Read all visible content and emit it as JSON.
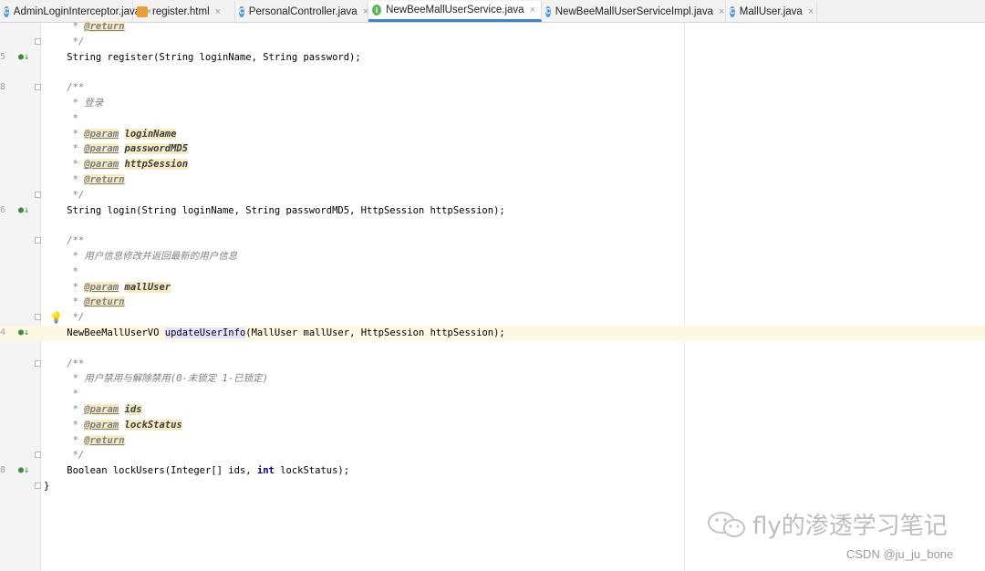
{
  "tabs": [
    {
      "icon": "c-class-icon",
      "label": "AdminLoginInterceptor.java",
      "active": false
    },
    {
      "icon": "html-file-icon",
      "label": "register.html",
      "active": false
    },
    {
      "icon": "c-class-icon",
      "label": "PersonalController.java",
      "active": false
    },
    {
      "icon": "i-interface-icon",
      "label": "NewBeeMallUserService.java",
      "active": true
    },
    {
      "icon": "c-class-icon",
      "label": "NewBeeMallUserServiceImpl.java",
      "active": false
    },
    {
      "icon": "c-class-icon",
      "label": "MallUser.java",
      "active": false
    }
  ],
  "tab_close_glyph": "×",
  "lines": [
    {
      "num": "",
      "gutter": "",
      "fold": false,
      "segments": [
        {
          "t": "     * ",
          "c": "cm"
        },
        {
          "t": "@return",
          "c": "tag"
        }
      ]
    },
    {
      "num": "",
      "gutter": "",
      "fold": true,
      "segments": [
        {
          "t": "     */",
          "c": "cm"
        }
      ]
    },
    {
      "num": "5",
      "gutter": "impl-icon",
      "fold": false,
      "segments": [
        {
          "t": "    String register(String loginName, String password);",
          "c": ""
        }
      ]
    },
    {
      "num": "",
      "gutter": "",
      "fold": false,
      "segments": []
    },
    {
      "num": "8",
      "gutter": "",
      "fold": true,
      "segments": [
        {
          "t": "    /**",
          "c": "cm"
        }
      ]
    },
    {
      "num": "",
      "gutter": "",
      "fold": false,
      "segments": [
        {
          "t": "     * 登录",
          "c": "cm"
        }
      ]
    },
    {
      "num": "",
      "gutter": "",
      "fold": false,
      "segments": [
        {
          "t": "     *",
          "c": "cm"
        }
      ]
    },
    {
      "num": "",
      "gutter": "",
      "fold": false,
      "segments": [
        {
          "t": "     * ",
          "c": "cm"
        },
        {
          "t": "@param",
          "c": "tag"
        },
        {
          "t": " ",
          "c": "cm"
        },
        {
          "t": "loginName",
          "c": "pn"
        }
      ]
    },
    {
      "num": "",
      "gutter": "",
      "fold": false,
      "segments": [
        {
          "t": "     * ",
          "c": "cm"
        },
        {
          "t": "@param",
          "c": "tag"
        },
        {
          "t": " ",
          "c": "cm"
        },
        {
          "t": "passwordMD5",
          "c": "pn"
        }
      ]
    },
    {
      "num": "",
      "gutter": "",
      "fold": false,
      "segments": [
        {
          "t": "     * ",
          "c": "cm"
        },
        {
          "t": "@param",
          "c": "tag"
        },
        {
          "t": " ",
          "c": "cm"
        },
        {
          "t": "httpSession",
          "c": "pn"
        }
      ]
    },
    {
      "num": "",
      "gutter": "",
      "fold": false,
      "segments": [
        {
          "t": "     * ",
          "c": "cm"
        },
        {
          "t": "@return",
          "c": "tag"
        }
      ]
    },
    {
      "num": "",
      "gutter": "",
      "fold": true,
      "segments": [
        {
          "t": "     */",
          "c": "cm"
        }
      ]
    },
    {
      "num": "6",
      "gutter": "impl-icon",
      "fold": false,
      "segments": [
        {
          "t": "    String login(String loginName, String passwordMD5, HttpSession httpSession);",
          "c": ""
        }
      ]
    },
    {
      "num": "",
      "gutter": "",
      "fold": false,
      "segments": []
    },
    {
      "num": "",
      "gutter": "",
      "fold": true,
      "segments": [
        {
          "t": "    /**",
          "c": "cm"
        }
      ]
    },
    {
      "num": "",
      "gutter": "",
      "fold": false,
      "segments": [
        {
          "t": "     * 用户信息修改并返回最新的用户信息",
          "c": "cm"
        }
      ]
    },
    {
      "num": "",
      "gutter": "",
      "fold": false,
      "segments": [
        {
          "t": "     *",
          "c": "cm"
        }
      ]
    },
    {
      "num": "",
      "gutter": "",
      "fold": false,
      "segments": [
        {
          "t": "     * ",
          "c": "cm"
        },
        {
          "t": "@param",
          "c": "tag"
        },
        {
          "t": " ",
          "c": "cm"
        },
        {
          "t": "mallUser",
          "c": "pn"
        }
      ]
    },
    {
      "num": "",
      "gutter": "",
      "fold": false,
      "segments": [
        {
          "t": "     * ",
          "c": "cm"
        },
        {
          "t": "@return",
          "c": "tag"
        }
      ]
    },
    {
      "num": "",
      "gutter": "",
      "fold": true,
      "bulb": true,
      "segments": [
        {
          "t": "     */",
          "c": "cm"
        }
      ]
    },
    {
      "num": "4",
      "gutter": "impl-icon",
      "fold": false,
      "caret": true,
      "segments": [
        {
          "t": "    NewBeeMallUserVO ",
          "c": ""
        },
        {
          "t": "updateUserInfo",
          "c": "hl"
        },
        {
          "t": "(MallUser mallUser, HttpSession httpSession);",
          "c": ""
        }
      ]
    },
    {
      "num": "",
      "gutter": "",
      "fold": false,
      "segments": []
    },
    {
      "num": "",
      "gutter": "",
      "fold": true,
      "segments": [
        {
          "t": "    /**",
          "c": "cm"
        }
      ]
    },
    {
      "num": "",
      "gutter": "",
      "fold": false,
      "segments": [
        {
          "t": "     * 用户禁用与解除禁用(0-未锁定 1-已锁定)",
          "c": "cm"
        }
      ]
    },
    {
      "num": "",
      "gutter": "",
      "fold": false,
      "segments": [
        {
          "t": "     *",
          "c": "cm"
        }
      ]
    },
    {
      "num": "",
      "gutter": "",
      "fold": false,
      "segments": [
        {
          "t": "     * ",
          "c": "cm"
        },
        {
          "t": "@param",
          "c": "tag"
        },
        {
          "t": " ",
          "c": "cm"
        },
        {
          "t": "ids",
          "c": "pn"
        }
      ]
    },
    {
      "num": "",
      "gutter": "",
      "fold": false,
      "segments": [
        {
          "t": "     * ",
          "c": "cm"
        },
        {
          "t": "@param",
          "c": "tag"
        },
        {
          "t": " ",
          "c": "cm"
        },
        {
          "t": "lockStatus",
          "c": "pn"
        }
      ]
    },
    {
      "num": "",
      "gutter": "",
      "fold": false,
      "segments": [
        {
          "t": "     * ",
          "c": "cm"
        },
        {
          "t": "@return",
          "c": "tag"
        }
      ]
    },
    {
      "num": "",
      "gutter": "",
      "fold": true,
      "segments": [
        {
          "t": "     */",
          "c": "cm"
        }
      ]
    },
    {
      "num": "8",
      "gutter": "impl-icon",
      "fold": false,
      "segments": [
        {
          "t": "    Boolean lockUsers(Integer[] ids, ",
          "c": ""
        },
        {
          "t": "int",
          "c": "kw"
        },
        {
          "t": " lockStatus);",
          "c": ""
        }
      ]
    },
    {
      "num": "",
      "gutter": "",
      "fold": true,
      "segments": [
        {
          "t": "}",
          "c": ""
        }
      ]
    }
  ],
  "watermark": {
    "text": "fly的渗透学习笔记",
    "icon": "wechat-icon"
  },
  "credit": "CSDN @ju_ju_bone"
}
